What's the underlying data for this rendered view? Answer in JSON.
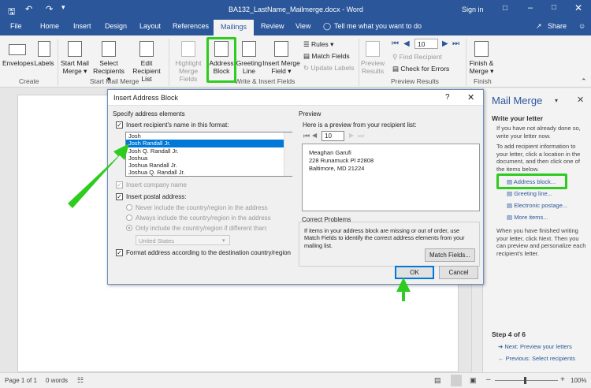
{
  "titlebar": {
    "document_title": "BA132_LastName_Mailmerge.docx - Word",
    "sign_in": "Sign in",
    "save_icon": "save-icon",
    "undo_icon": "undo-icon",
    "redo_icon": "redo-icon",
    "customize_icon": "customize-toolbar-icon"
  },
  "tabs": [
    {
      "label": "File"
    },
    {
      "label": "Home"
    },
    {
      "label": "Insert"
    },
    {
      "label": "Design"
    },
    {
      "label": "Layout"
    },
    {
      "label": "References"
    },
    {
      "label": "Mailings"
    },
    {
      "label": "Review"
    },
    {
      "label": "View"
    }
  ],
  "tell_me": "Tell me what you want to do",
  "share": "Share",
  "ribbon": {
    "create": {
      "label": "Create",
      "envelopes": "Envelopes",
      "labels": "Labels"
    },
    "start": {
      "label": "Start Mail Merge",
      "start_mm_1": "Start Mail",
      "start_mm_2": "Merge",
      "select_1": "Select",
      "select_2": "Recipients",
      "edit_1": "Edit",
      "edit_2": "Recipient List"
    },
    "write": {
      "label": "Write & Insert Fields",
      "highlight_1": "Highlight",
      "highlight_2": "Merge Fields",
      "address_1": "Address",
      "address_2": "Block",
      "greeting_1": "Greeting",
      "greeting_2": "Line",
      "insert_1": "Insert Merge",
      "insert_2": "Field",
      "rules": "Rules",
      "match": "Match Fields",
      "update": "Update Labels"
    },
    "preview": {
      "label": "Preview Results",
      "preview_1": "Preview",
      "preview_2": "Results",
      "record": "10",
      "find": "Find Recipient",
      "check": "Check for Errors"
    },
    "finish": {
      "label": "Finish",
      "finish_1": "Finish &",
      "finish_2": "Merge"
    }
  },
  "dialog": {
    "title": "Insert Address Block",
    "help": "?",
    "specify_label": "Specify address elements",
    "insert_name_label": "Insert recipient's name in this format:",
    "name_formats": [
      "Josh",
      "Josh Randall Jr.",
      "Josh Q. Randall Jr.",
      "Joshua",
      "Joshua Randall Jr.",
      "Joshua Q. Randall Jr."
    ],
    "selected_index": 1,
    "company_label": "Insert company name",
    "postal_label": "Insert postal address:",
    "radio_never": "Never include the country/region in the address",
    "radio_always": "Always include the country/region in the address",
    "radio_only": "Only include the country/region if different than:",
    "country_value": "United States",
    "format_label": "Format address according to the destination country/region",
    "preview_label": "Preview",
    "preview_desc": "Here is a preview from your recipient list:",
    "preview_record": "10",
    "address_lines": [
      "Meaghan Garufi",
      "228 Runamuck Pl #2808",
      "Baltimore, MD 21224"
    ],
    "correct_label": "Correct Problems",
    "correct_text": "If items in your address block are missing or out of order, use Match Fields to identify the correct address elements from your mailing list.",
    "match_button": "Match Fields...",
    "ok": "OK",
    "cancel": "Cancel"
  },
  "pane": {
    "title": "Mail Merge",
    "write_heading": "Write your letter",
    "text1": "If you have not already done so, write your letter now.",
    "text2": "To add recipient information to your letter, click a location in the document, and then click one of the items below.",
    "links": [
      "Address block...",
      "Greeting line...",
      "Electronic postage...",
      "More items..."
    ],
    "text3": "When you have finished writing your letter, click Next. Then you can preview and personalize each recipient's letter.",
    "step": "Step 4 of 6",
    "next": "Next: Preview your letters",
    "prev": "Previous: Select recipients"
  },
  "status": {
    "page": "Page 1 of 1",
    "words": "0 words",
    "zoom": "100%"
  },
  "colors": {
    "accent": "#2b579a",
    "highlight": "#2ecc1f",
    "selection": "#0078d7"
  }
}
